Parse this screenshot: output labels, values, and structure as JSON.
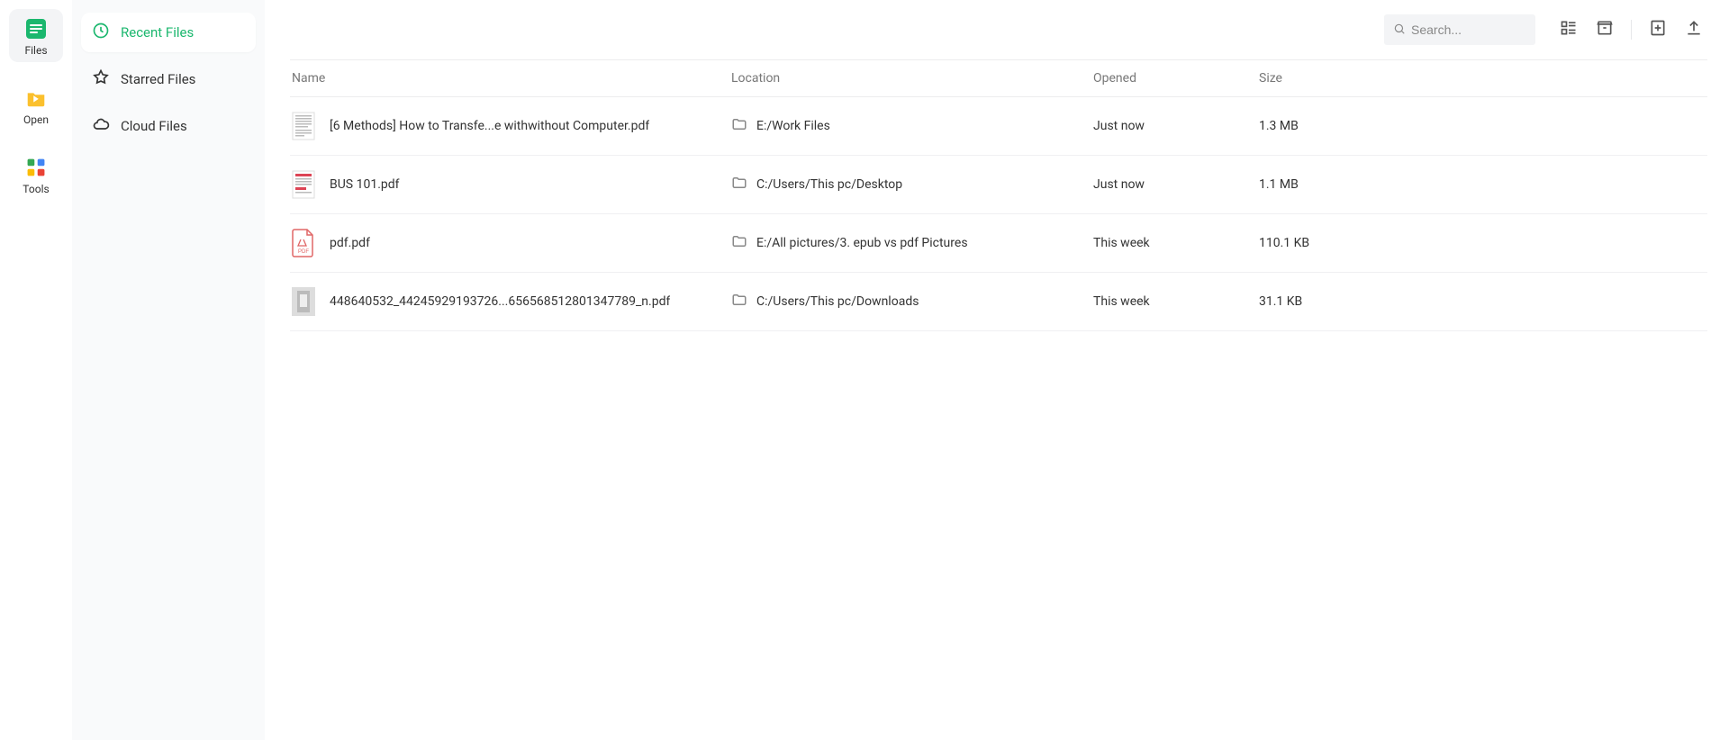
{
  "rail": {
    "items": [
      {
        "label": "Files",
        "active": true
      },
      {
        "label": "Open",
        "active": false
      },
      {
        "label": "Tools",
        "active": false
      }
    ]
  },
  "sidebar": {
    "items": [
      {
        "label": "Recent Files",
        "active": true,
        "icon": "clock-icon"
      },
      {
        "label": "Starred Files",
        "active": false,
        "icon": "star-icon"
      },
      {
        "label": "Cloud Files",
        "active": false,
        "icon": "cloud-icon"
      }
    ]
  },
  "toolbar": {
    "search_placeholder": "Search..."
  },
  "table": {
    "headers": {
      "name": "Name",
      "location": "Location",
      "opened": "Opened",
      "size": "Size"
    },
    "rows": [
      {
        "name": "[6 Methods] How to Transfe...e withwithout Computer.pdf",
        "location": "E:/Work Files",
        "opened": "Just now",
        "size": "1.3 MB",
        "thumb": "doc-a"
      },
      {
        "name": "BUS 101.pdf",
        "location": "C:/Users/This pc/Desktop",
        "opened": "Just now",
        "size": "1.1 MB",
        "thumb": "doc-b"
      },
      {
        "name": "pdf.pdf",
        "location": "E:/All pictures/3. epub vs pdf Pictures",
        "opened": "This week",
        "size": "110.1 KB",
        "thumb": "pdf-icon"
      },
      {
        "name": "448640532_44245929193726...656568512801347789_n.pdf",
        "location": "C:/Users/This pc/Downloads",
        "opened": "This week",
        "size": "31.1 KB",
        "thumb": "image"
      }
    ]
  }
}
